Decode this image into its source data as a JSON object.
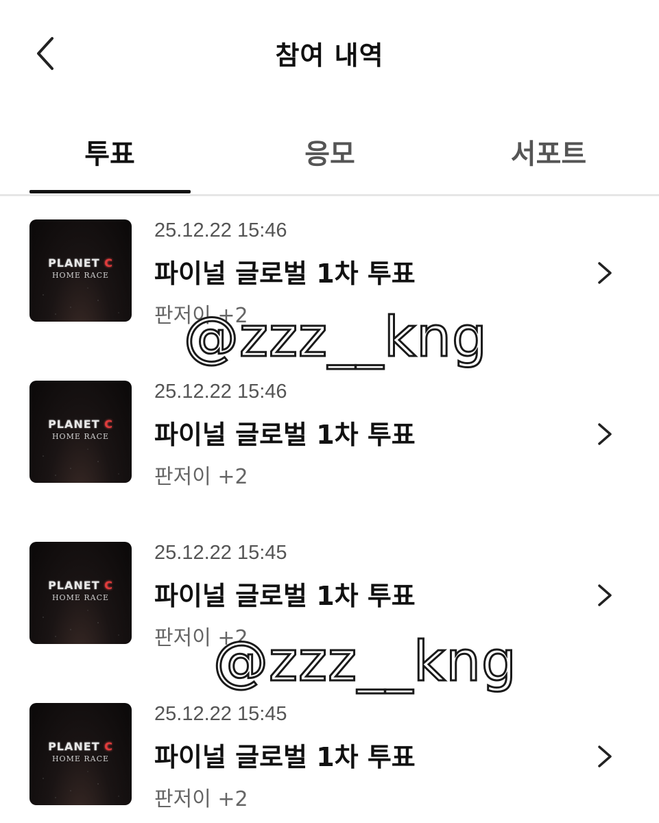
{
  "header": {
    "title": "참여 내역",
    "back_icon": "chevron-left-icon"
  },
  "tabs": [
    {
      "label": "투표",
      "active": true
    },
    {
      "label": "응모",
      "active": false
    },
    {
      "label": "서포트",
      "active": false
    }
  ],
  "items": [
    {
      "date": "25.12.22 15:46",
      "title": "파이널 글로벌 1차 투표",
      "subtitle": "판저이 +2",
      "thumb_line1": "PLANET",
      "thumb_c": "C",
      "thumb_line2": "HOME RACE"
    },
    {
      "date": "25.12.22 15:46",
      "title": "파이널 글로벌 1차 투표",
      "subtitle": "판저이 +2",
      "thumb_line1": "PLANET",
      "thumb_c": "C",
      "thumb_line2": "HOME RACE"
    },
    {
      "date": "25.12.22 15:45",
      "title": "파이널 글로벌 1차 투표",
      "subtitle": "판저이 +2",
      "thumb_line1": "PLANET",
      "thumb_c": "C",
      "thumb_line2": "HOME RACE"
    },
    {
      "date": "25.12.22 15:45",
      "title": "파이널 글로벌 1차 투표",
      "subtitle": "판저이 +2",
      "thumb_line1": "PLANET",
      "thumb_c": "C",
      "thumb_line2": "HOME RACE"
    }
  ],
  "watermark": "@zzz__kng",
  "colors": {
    "text": "#111111",
    "muted": "#666666",
    "divider": "#e6e6e6",
    "logo_accent": "#e23b3b"
  }
}
